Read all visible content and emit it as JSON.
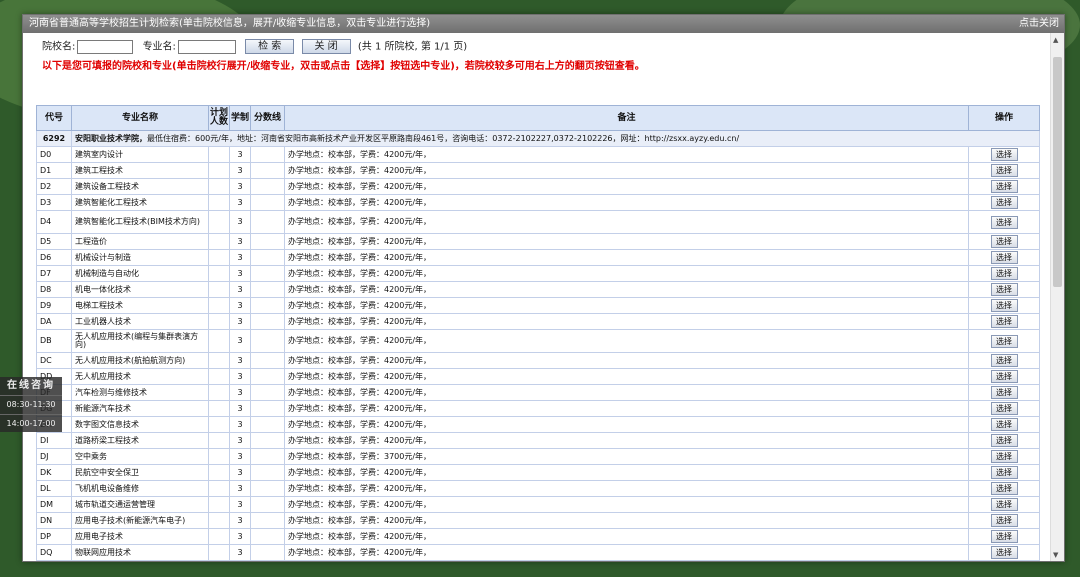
{
  "dialog": {
    "title": "河南省普通高等学校招生计划检索(单击院校信息，展开/收缩专业信息，双击专业进行选择)",
    "close_label": "点击关闭"
  },
  "search": {
    "school_label": "院校名:",
    "major_label": "专业名:",
    "search_btn": "检 索",
    "close_btn": "关 闭",
    "summary": "(共 1 所院校, 第 1/1 页)"
  },
  "notice": "以下是您可填报的院校和专业(单击院校行展开/收缩专业，双击或点击【选择】按钮选中专业)，若院校较多可用右上方的翻页按钮查看。",
  "table": {
    "headers": [
      "代号",
      "专业名称",
      "计划人数",
      "学制",
      "分数线",
      "备注",
      "操作"
    ],
    "school": {
      "code": "6292",
      "name": "安阳职业技术学院",
      "remark": "最低住宿费：600元/年，地址：河南省安阳市高新技术产业开发区平原路南段461号，咨询电话：0372-2102227,0372-2102226，网址：http://zsxx.ayzy.edu.cn/"
    },
    "select_label": "选择",
    "rows": [
      {
        "code": "D0",
        "name": "建筑室内设计",
        "plan": "",
        "years": "3",
        "score": "",
        "remark": "办学地点：校本部，学费：4200元/年，"
      },
      {
        "code": "D1",
        "name": "建筑工程技术",
        "plan": "",
        "years": "3",
        "score": "",
        "remark": "办学地点：校本部，学费：4200元/年，"
      },
      {
        "code": "D2",
        "name": "建筑设备工程技术",
        "plan": "",
        "years": "3",
        "score": "",
        "remark": "办学地点：校本部，学费：4200元/年，"
      },
      {
        "code": "D3",
        "name": "建筑智能化工程技术",
        "plan": "",
        "years": "3",
        "score": "",
        "remark": "办学地点：校本部，学费：4200元/年，"
      },
      {
        "code": "D4",
        "name": "建筑智能化工程技术(BIM技术方向)",
        "plan": "",
        "years": "3",
        "score": "",
        "remark": "办学地点：校本部，学费：4200元/年，"
      },
      {
        "code": "D5",
        "name": "工程造价",
        "plan": "",
        "years": "3",
        "score": "",
        "remark": "办学地点：校本部，学费：4200元/年，"
      },
      {
        "code": "D6",
        "name": "机械设计与制造",
        "plan": "",
        "years": "3",
        "score": "",
        "remark": "办学地点：校本部，学费：4200元/年，"
      },
      {
        "code": "D7",
        "name": "机械制造与自动化",
        "plan": "",
        "years": "3",
        "score": "",
        "remark": "办学地点：校本部，学费：4200元/年，"
      },
      {
        "code": "D8",
        "name": "机电一体化技术",
        "plan": "",
        "years": "3",
        "score": "",
        "remark": "办学地点：校本部，学费：4200元/年，"
      },
      {
        "code": "D9",
        "name": "电梯工程技术",
        "plan": "",
        "years": "3",
        "score": "",
        "remark": "办学地点：校本部，学费：4200元/年，"
      },
      {
        "code": "DA",
        "name": "工业机器人技术",
        "plan": "",
        "years": "3",
        "score": "",
        "remark": "办学地点：校本部，学费：4200元/年，"
      },
      {
        "code": "DB",
        "name": "无人机应用技术(编程与集群表演方向)",
        "plan": "",
        "years": "3",
        "score": "",
        "remark": "办学地点：校本部，学费：4200元/年，"
      },
      {
        "code": "DC",
        "name": "无人机应用技术(航拍航测方向)",
        "plan": "",
        "years": "3",
        "score": "",
        "remark": "办学地点：校本部，学费：4200元/年，"
      },
      {
        "code": "DD",
        "name": "无人机应用技术",
        "plan": "",
        "years": "3",
        "score": "",
        "remark": "办学地点：校本部，学费：4200元/年，"
      },
      {
        "code": "DF",
        "name": "汽车检测与维修技术",
        "plan": "",
        "years": "3",
        "score": "",
        "remark": "办学地点：校本部，学费：4200元/年，"
      },
      {
        "code": "DG",
        "name": "新能源汽车技术",
        "plan": "",
        "years": "3",
        "score": "",
        "remark": "办学地点：校本部，学费：4200元/年，"
      },
      {
        "code": "DH",
        "name": "数字图文信息技术",
        "plan": "",
        "years": "3",
        "score": "",
        "remark": "办学地点：校本部，学费：4200元/年，"
      },
      {
        "code": "DI",
        "name": "道路桥梁工程技术",
        "plan": "",
        "years": "3",
        "score": "",
        "remark": "办学地点：校本部，学费：4200元/年，"
      },
      {
        "code": "DJ",
        "name": "空中乘务",
        "plan": "",
        "years": "3",
        "score": "",
        "remark": "办学地点：校本部，学费：3700元/年，"
      },
      {
        "code": "DK",
        "name": "民航空中安全保卫",
        "plan": "",
        "years": "3",
        "score": "",
        "remark": "办学地点：校本部，学费：4200元/年，"
      },
      {
        "code": "DL",
        "name": "飞机机电设备维修",
        "plan": "",
        "years": "3",
        "score": "",
        "remark": "办学地点：校本部，学费：4200元/年，"
      },
      {
        "code": "DM",
        "name": "城市轨道交通运营管理",
        "plan": "",
        "years": "3",
        "score": "",
        "remark": "办学地点：校本部，学费：4200元/年，"
      },
      {
        "code": "DN",
        "name": "应用电子技术(新能源汽车电子)",
        "plan": "",
        "years": "3",
        "score": "",
        "remark": "办学地点：校本部，学费：4200元/年，"
      },
      {
        "code": "DP",
        "name": "应用电子技术",
        "plan": "",
        "years": "3",
        "score": "",
        "remark": "办学地点：校本部，学费：4200元/年，"
      },
      {
        "code": "DQ",
        "name": "物联网应用技术",
        "plan": "",
        "years": "3",
        "score": "",
        "remark": "办学地点：校本部，学费：4200元/年，"
      }
    ]
  },
  "side_widget": {
    "title": "在线咨询",
    "hours": [
      "08:30-11:30",
      "14:00-17:00"
    ]
  }
}
